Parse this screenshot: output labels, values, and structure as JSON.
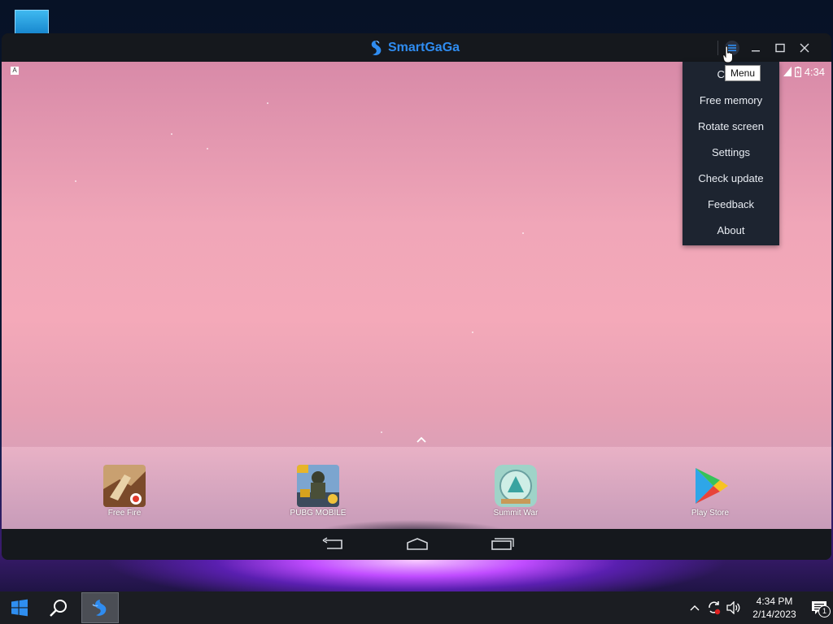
{
  "window": {
    "brand": "SmartGaGa"
  },
  "status_bar": {
    "left_badge": "A",
    "time": "4:34"
  },
  "menu": {
    "tooltip": "Menu",
    "items": [
      {
        "label": "Clean"
      },
      {
        "label": "Free memory"
      },
      {
        "label": "Rotate screen"
      },
      {
        "label": "Settings"
      },
      {
        "label": "Check update"
      },
      {
        "label": "Feedback"
      },
      {
        "label": "About"
      }
    ]
  },
  "dock": {
    "apps": [
      {
        "label": "Free Fire",
        "icon": "free-fire-icon"
      },
      {
        "label": "PUBG MOBILE",
        "icon": "pubg-mobile-icon"
      },
      {
        "label": "Summit War",
        "icon": "summit-war-icon"
      },
      {
        "label": "Play Store",
        "icon": "play-store-icon"
      }
    ]
  },
  "taskbar": {
    "time": "4:34 PM",
    "date": "2/14/2023",
    "notification_count": "1"
  },
  "colors": {
    "brand": "#2f8cf0",
    "menu_bg": "#1d2430",
    "wallpaper": "#f0a6b8"
  }
}
